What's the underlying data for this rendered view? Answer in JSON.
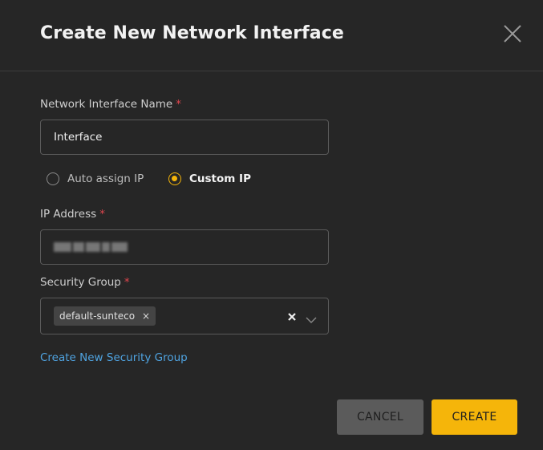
{
  "dialog": {
    "title": "Create New Network Interface"
  },
  "form": {
    "name_field": {
      "label": "Network Interface Name",
      "required_mark": "*",
      "value": "Interface"
    },
    "ip_mode": {
      "options": [
        {
          "label": "Auto assign IP",
          "checked": false
        },
        {
          "label": "Custom IP",
          "checked": true
        }
      ]
    },
    "ip_field": {
      "label": "IP Address",
      "required_mark": "*"
    },
    "security_group": {
      "label": "Security Group",
      "required_mark": "*",
      "selected_tags": [
        "default-sunteco"
      ],
      "tag_remove_glyph": "×"
    },
    "create_security_group_link": "Create New Security Group"
  },
  "actions": {
    "cancel_label": "CANCEL",
    "create_label": "CREATE"
  },
  "colors": {
    "accent": "#f5b50a",
    "link": "#4fa3e0",
    "required": "#e0464e",
    "background": "#262626"
  }
}
